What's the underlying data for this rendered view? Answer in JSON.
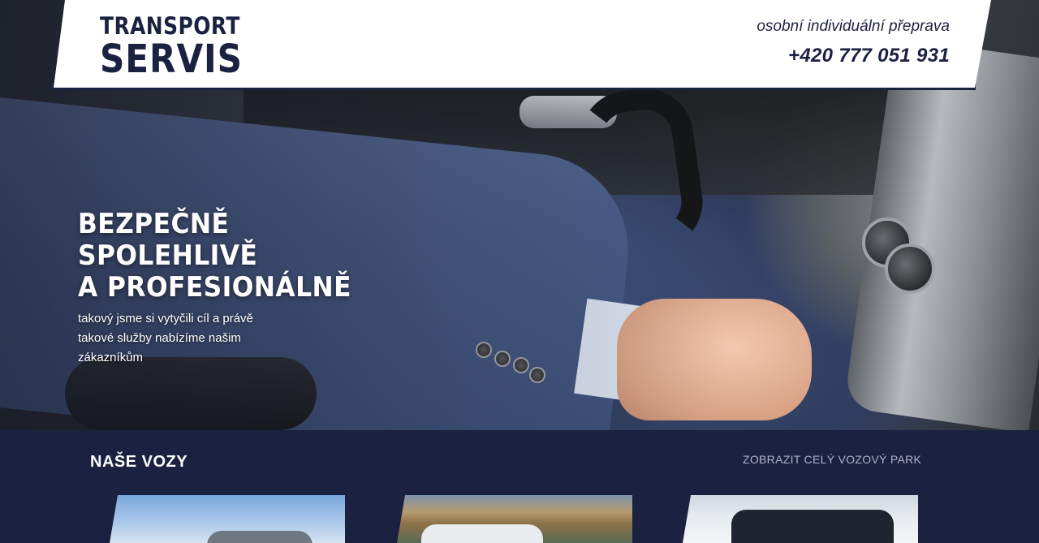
{
  "brand": {
    "line1": "TRANSPORT",
    "line2": "SERVIS",
    "color": "#1b2140"
  },
  "header": {
    "tagline": "osobní individuální přeprava",
    "phone": "+420 777 051 931"
  },
  "hero": {
    "title_lines": [
      "BEZPEČNĚ",
      "SPOLEHLIVĚ",
      "A PROFESIONÁLNĚ"
    ],
    "subtitle": "takový jsme si vytyčili cíl a právě takové služby nabízíme našim zákazníkům"
  },
  "cars": {
    "title": "NAŠE VOZY",
    "link": "ZOBRAZIT CELÝ VOZOVÝ PARK",
    "background": "#1b2140"
  }
}
